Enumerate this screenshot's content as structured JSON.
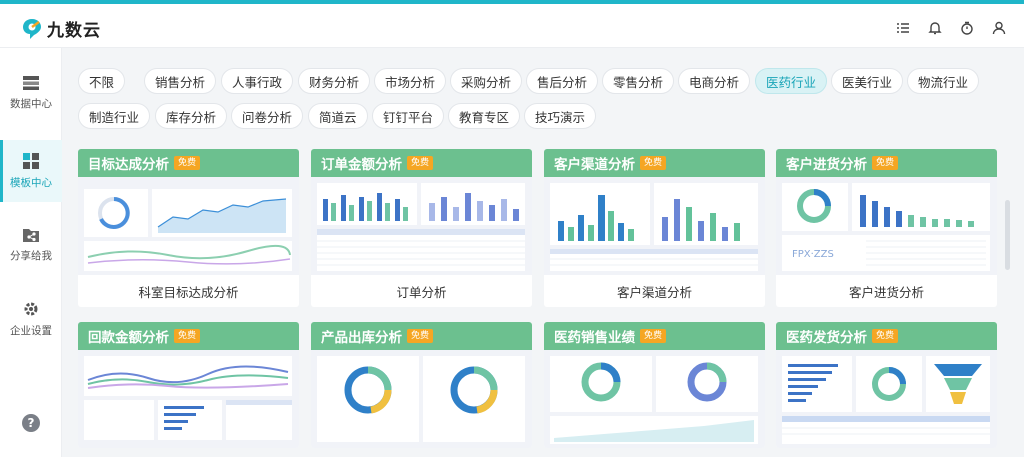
{
  "app": {
    "name": "九数云"
  },
  "header": {
    "icons": [
      "list-icon",
      "bell-icon",
      "timer-icon",
      "user-icon"
    ]
  },
  "sidebar": {
    "items": [
      {
        "label": "数据中心",
        "icon": "database-icon",
        "active": false
      },
      {
        "label": "模板中心",
        "icon": "template-icon",
        "active": true
      },
      {
        "label": "分享给我",
        "icon": "share-icon",
        "active": false
      },
      {
        "label": "企业设置",
        "icon": "gear-icon",
        "active": false
      }
    ],
    "help": "?"
  },
  "filters": {
    "row1": [
      "不限",
      "销售分析",
      "人事行政",
      "财务分析",
      "市场分析",
      "采购分析",
      "售后分析",
      "零售分析",
      "电商分析",
      "医药行业",
      "医美行业",
      "物流行业"
    ],
    "row2": [
      "制造行业",
      "库存分析",
      "问卷分析",
      "简道云",
      "钉钉平台",
      "教育专区",
      "技巧演示"
    ],
    "active": "医药行业"
  },
  "free_badge": "免费",
  "cards": [
    {
      "title": "目标达成分析",
      "footer": "科室目标达成分析"
    },
    {
      "title": "订单金额分析",
      "footer": "订单分析"
    },
    {
      "title": "客户渠道分析",
      "footer": "客户渠道分析"
    },
    {
      "title": "客户进货分析",
      "footer": "客户进货分析"
    },
    {
      "title": "回款金额分析",
      "footer": ""
    },
    {
      "title": "产品出库分析",
      "footer": ""
    },
    {
      "title": "医药销售业绩",
      "footer": ""
    },
    {
      "title": "医药发货分析",
      "footer": ""
    }
  ],
  "colors": {
    "accent": "#1fb6c9",
    "card_header": "#6cc08f",
    "badge": "#f5a623"
  }
}
